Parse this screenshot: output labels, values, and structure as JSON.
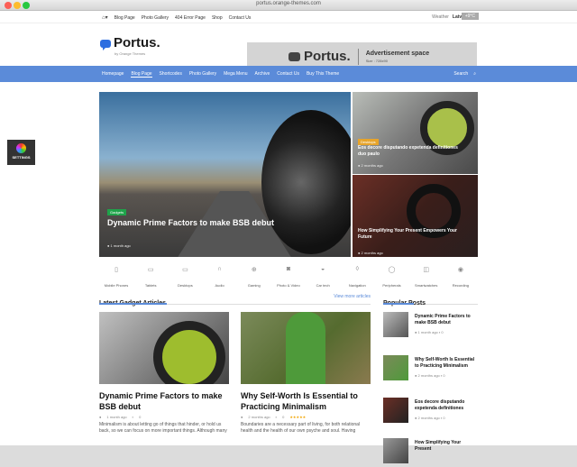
{
  "browser": {
    "url": "portus.orange-themes.com"
  },
  "topbar": {
    "links": [
      "Blog Page",
      "Photo Gallery",
      "404 Error Page",
      "Shop",
      "Contact Us"
    ],
    "weather_label": "Weather",
    "city": "Latvia, Riga",
    "temperature": "+9°C"
  },
  "logo": {
    "name": "Portus.",
    "sub": "by Orange Themes"
  },
  "ad": {
    "brand": "Portus.",
    "title": "Advertisement space",
    "size": "Size : 728x90"
  },
  "nav": {
    "items": [
      "Homepage",
      "Blog Page",
      "Shortcodes",
      "Photo Gallery",
      "Mega Menu",
      "Archive",
      "Contact Us",
      "Buy This Theme"
    ],
    "active": "Blog Page",
    "search_label": "Search"
  },
  "settings": {
    "label": "SETTINGS"
  },
  "hero": {
    "main": {
      "tag": "Gadgets",
      "title": "Dynamic Prime Factors to make BSB debut",
      "meta": "1 month ago"
    },
    "side": [
      {
        "tag": "Desktops",
        "title": "Eos decore disputando expetenda definitiones duo paulo",
        "meta": "2 months ago"
      },
      {
        "tag": "",
        "title": "How Simplifying Your Present Empowers Your Future",
        "meta": "2 months ago"
      }
    ]
  },
  "categories": [
    {
      "label": "Mobile Phones",
      "icon": "phone-icon"
    },
    {
      "label": "Tablets",
      "icon": "tablet-icon"
    },
    {
      "label": "Desktops",
      "icon": "desktop-icon"
    },
    {
      "label": "Audio",
      "icon": "headphones-icon"
    },
    {
      "label": "Gaming",
      "icon": "gamepad-icon"
    },
    {
      "label": "Photo & Video",
      "icon": "camera-icon"
    },
    {
      "label": "Car tech",
      "icon": "car-icon"
    },
    {
      "label": "Navigation",
      "icon": "pin-icon"
    },
    {
      "label": "Peripherals",
      "icon": "mouse-icon"
    },
    {
      "label": "Smartwatches",
      "icon": "watch-icon"
    },
    {
      "label": "Recording",
      "icon": "mic-icon"
    }
  ],
  "latest": {
    "title": "Latest Gadget Articles",
    "more": "View more articles",
    "cards": [
      {
        "title": "Dynamic Prime Factors to make BSB debut",
        "meta": "1 month ago",
        "comments": "0",
        "text": "Minimalism is about letting go of things that hinder, or hold us back, so we can focus on more important things. Although many"
      },
      {
        "title": "Why Self-Worth Is Essential to Practicing Minimalism",
        "meta": "2 months ago",
        "comments": "0",
        "stars": "★★★★★",
        "text": "Boundaries are a necessary part of living, for both relational health and the health of our own psyche and soul. Having"
      }
    ]
  },
  "popular": {
    "title": "Popular Posts",
    "items": [
      {
        "title": "Dynamic Prime Factors to make BSB debut",
        "meta": "1 month ago",
        "comments": "0"
      },
      {
        "title": "Why Self-Worth Is Essential to Practicing Minimalism",
        "meta": "2 months ago",
        "comments": "0"
      },
      {
        "title": "Eos decore disputando expetenda definitiones",
        "meta": "2 months ago",
        "comments": "0"
      },
      {
        "title": "How Simplifying Your Present",
        "meta": "",
        "comments": ""
      }
    ]
  }
}
